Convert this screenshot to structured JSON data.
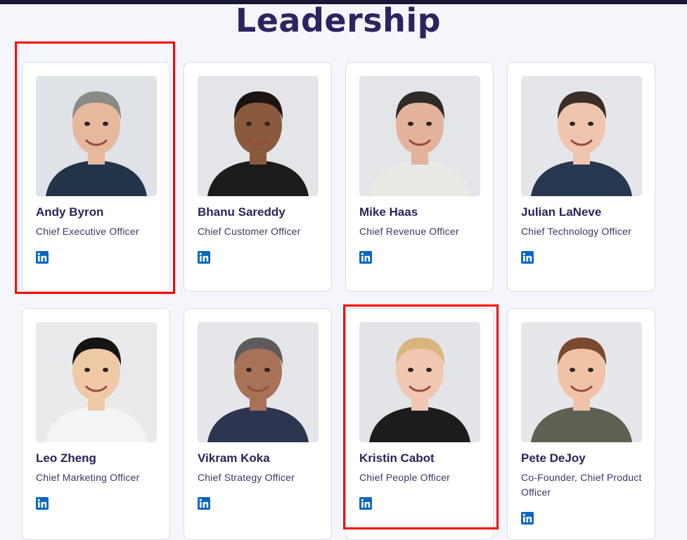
{
  "page": {
    "title": "Leadership"
  },
  "colors": {
    "heading": "#2b2461",
    "linkedin": "#0a66c2",
    "highlight": "#ff0000",
    "background": "#f4f6fc"
  },
  "leaders": [
    {
      "name": "Andy Byron",
      "role": "Chief Executive Officer",
      "social_icon": "linkedin-icon",
      "highlighted": true
    },
    {
      "name": "Bhanu Sareddy",
      "role": "Chief Customer Officer",
      "social_icon": "linkedin-icon",
      "highlighted": false
    },
    {
      "name": "Mike Haas",
      "role": "Chief Revenue Officer",
      "social_icon": "linkedin-icon",
      "highlighted": false
    },
    {
      "name": "Julian LaNeve",
      "role": "Chief Technology Officer",
      "social_icon": "linkedin-icon",
      "highlighted": false
    },
    {
      "name": "Leo Zheng",
      "role": "Chief Marketing Officer",
      "social_icon": "linkedin-icon",
      "highlighted": false
    },
    {
      "name": "Vikram Koka",
      "role": "Chief Strategy Officer",
      "social_icon": "linkedin-icon",
      "highlighted": false
    },
    {
      "name": "Kristin Cabot",
      "role": "Chief People Officer",
      "social_icon": "linkedin-icon",
      "highlighted": true
    },
    {
      "name": "Pete DeJoy",
      "role": "Co-Founder, Chief Product Officer",
      "social_icon": "linkedin-icon",
      "highlighted": false
    }
  ]
}
